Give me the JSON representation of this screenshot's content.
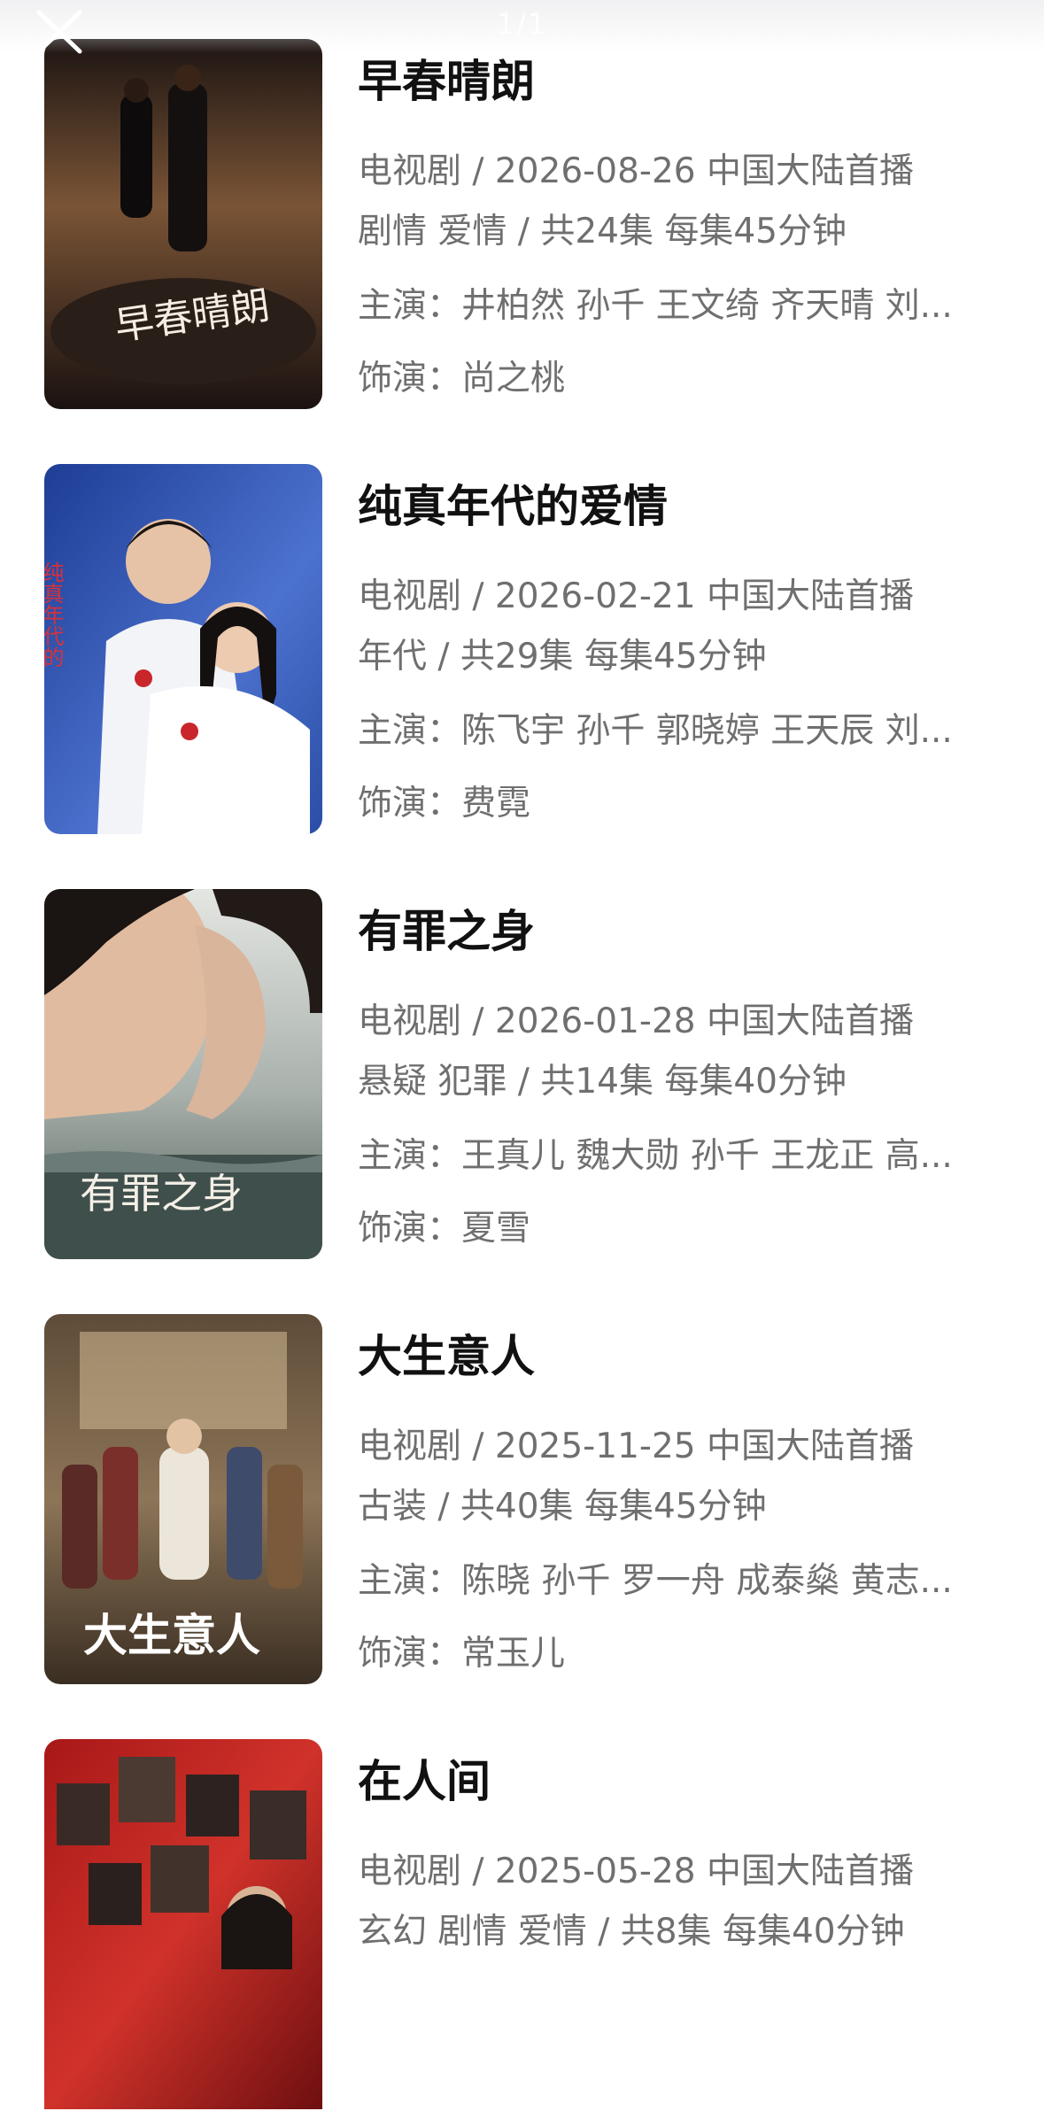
{
  "header": {
    "page_indicator": "1/1"
  },
  "colors": {
    "title": "#111111",
    "meta_text": "#6f6f6f",
    "background": "#ffffff"
  },
  "labels": {
    "cast_prefix": "主演：",
    "role_prefix": "饰演："
  },
  "items": [
    {
      "title": "早春晴朗",
      "line1": "电视剧 / 2026-08-26 中国大陆首播",
      "line2": "剧情 爱情 / 共24集 每集45分钟",
      "cast": "井柏然 孙千 王文绮 齐天晴 刘...",
      "role": "尚之桃",
      "poster_text": "早春晴朗",
      "poster_colors": [
        "#2a1a14",
        "#6b4a35",
        "#1a1210"
      ]
    },
    {
      "title": "纯真年代的爱情",
      "line1": "电视剧 / 2026-02-21 中国大陆首播",
      "line2": "年代 / 共29集 每集45分钟",
      "cast": "陈飞宇 孙千 郭晓婷 王天辰 刘...",
      "role": "费霓",
      "poster_text": "纯真年代的爱情",
      "poster_colors": [
        "#2b4fa8",
        "#5b7fd6",
        "#e9eef8"
      ]
    },
    {
      "title": "有罪之身",
      "line1": "电视剧 / 2026-01-28 中国大陆首播",
      "line2": "悬疑 犯罪 / 共14集 每集40分钟",
      "cast": "王真儿 魏大勋 孙千 王龙正 高...",
      "role": "夏雪",
      "poster_text": "有罪之身",
      "poster_colors": [
        "#c9cdc8",
        "#8a948f",
        "#4d5a56"
      ]
    },
    {
      "title": "大生意人",
      "line1": "电视剧 / 2025-11-25 中国大陆首播",
      "line2": "古装 / 共40集 每集45分钟",
      "cast": "陈晓 孙千 罗一舟 成泰燊 黄志...",
      "role": "常玉儿",
      "poster_text": "大生意人",
      "poster_colors": [
        "#6b5a44",
        "#9b8466",
        "#3a2e22"
      ]
    },
    {
      "title": "在人间",
      "line1": "电视剧 / 2025-05-28 中国大陆首播",
      "line2": "玄幻 剧情 爱情 / 共8集 每集40分钟",
      "cast": "",
      "role": "",
      "poster_text": "",
      "poster_colors": [
        "#b01e1e",
        "#d63a2e",
        "#6e0f10"
      ]
    }
  ]
}
